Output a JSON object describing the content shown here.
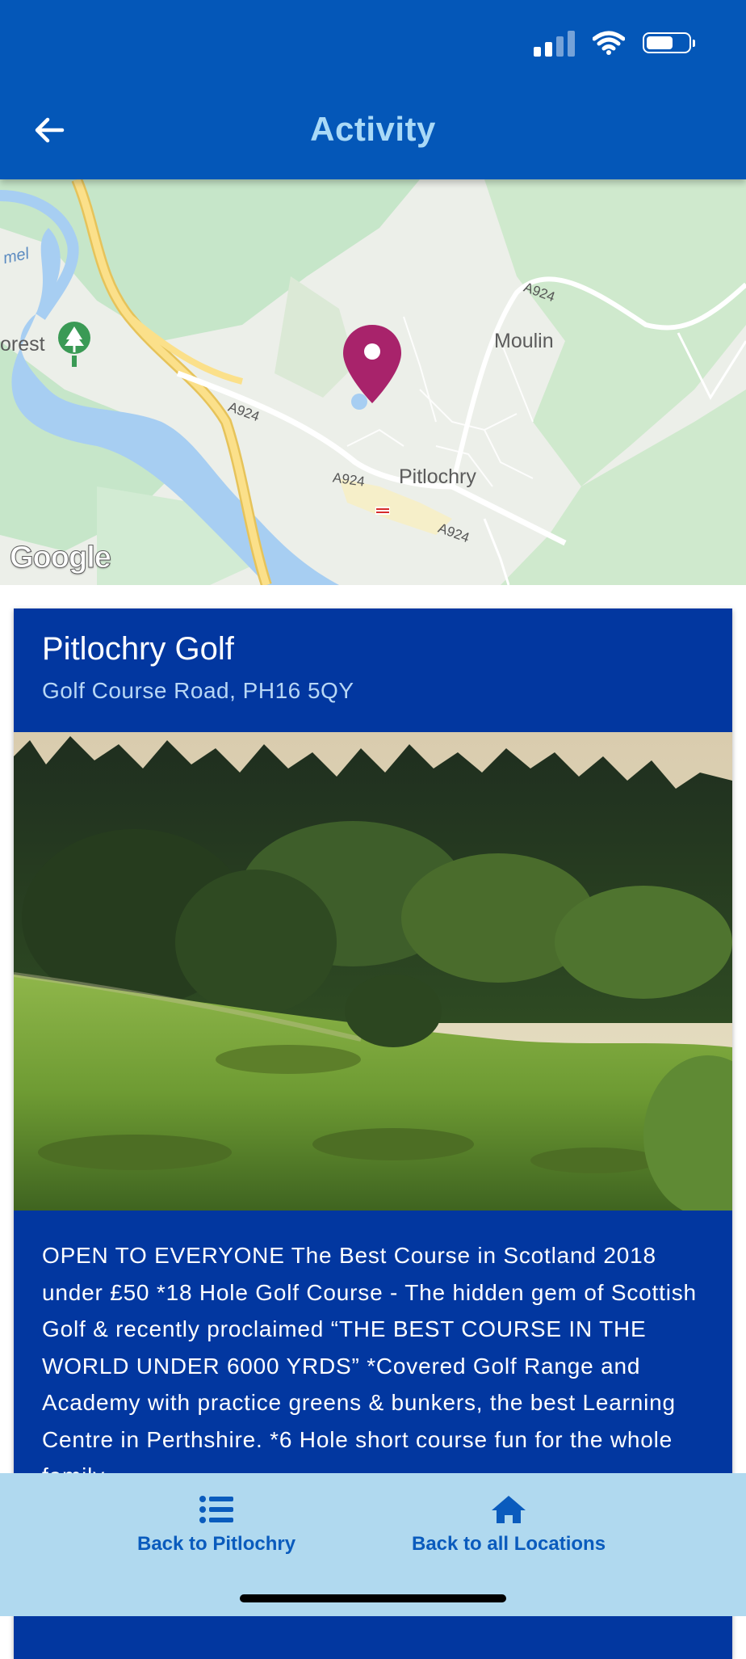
{
  "header": {
    "title": "Activity",
    "back_icon": "arrow-left-icon"
  },
  "map": {
    "places": {
      "moulin": "Moulin",
      "pitlochry": "Pitlochry",
      "forest": "orest",
      "lake": "mel"
    },
    "roads": [
      "A924",
      "A924",
      "A924",
      "A924"
    ],
    "attribution": "Google"
  },
  "card": {
    "title": "Pitlochry Golf",
    "address": "Golf Course Road, PH16 5QY",
    "description": "OPEN TO EVERYONE The Best Course in Scotland 2018 under £50 *18 Hole Golf Course - The hidden gem of Scottish Golf & recently proclaimed “THE BEST COURSE IN THE WORLD UNDER 6000 YRDS” *Covered Golf Range and Academy with practice greens & bunkers, the best Learning Centre in Perthshire. *6 Hole short course fun for the whole family."
  },
  "bottom_nav": {
    "left": {
      "label": "Back to Pitlochry",
      "icon": "list-icon"
    },
    "right": {
      "label": "Back to all Locations",
      "icon": "home-icon"
    }
  },
  "colors": {
    "header": "#0457b8",
    "title": "#a9d9f7",
    "card": "#0237a0",
    "nav_bg": "#b0d9ef",
    "nav_text": "#0a5bbd",
    "pin": "#a8236b"
  }
}
